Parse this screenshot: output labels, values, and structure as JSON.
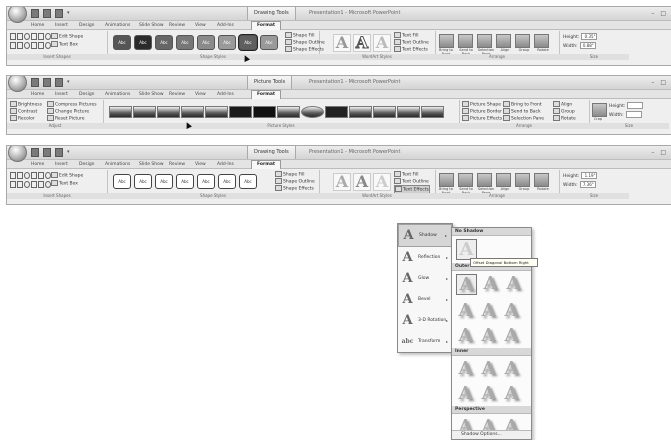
{
  "window_title": "Presentation1 - Microsoft PowerPoint",
  "tabs": [
    "Home",
    "Insert",
    "Design",
    "Animations",
    "Slide Show",
    "Review",
    "View",
    "Add-Ins"
  ],
  "ribbon1": {
    "tools_label": "Drawing Tools",
    "format_tab": "Format",
    "edit_shape": "Edit Shape",
    "text_box": "Text Box",
    "style_label": "Abc",
    "shape_fill": "Shape Fill",
    "shape_outline": "Shape Outline",
    "shape_effects": "Shape Effects",
    "text_fill": "Text Fill",
    "text_outline": "Text Outline",
    "text_effects": "Text Effects",
    "arrange": [
      "Bring to Front",
      "Send to Back",
      "Selection Pane",
      "Align",
      "Group",
      "Rotate"
    ],
    "height_label": "Height:",
    "height_value": "0.35\"",
    "width_label": "Width:",
    "width_value": "0.88\"",
    "groups": [
      "Insert Shapes",
      "Shape Styles",
      "WordArt Styles",
      "Arrange",
      "Size"
    ]
  },
  "ribbon2": {
    "tools_label": "Picture Tools",
    "format_tab": "Format",
    "adjust": [
      "Brightness",
      "Contrast",
      "Recolor",
      "Compress Pictures",
      "Change Picture",
      "Reset Picture"
    ],
    "picture_shape": "Picture Shape",
    "picture_border": "Picture Border",
    "picture_effects": "Picture Effects",
    "arrange": [
      "Bring to Front",
      "Send to Back",
      "Selection Pane",
      "Align",
      "Group",
      "Rotate"
    ],
    "height_label": "Height:",
    "width_label": "Width:",
    "crop": "Crop",
    "groups": [
      "Adjust",
      "Picture Styles",
      "Arrange",
      "Size"
    ]
  },
  "ribbon3": {
    "tools_label": "Drawing Tools",
    "format_tab": "Format",
    "edit_shape": "Edit Shape",
    "text_box": "Text Box",
    "style_label": "Abc",
    "shape_fill": "Shape Fill",
    "shape_outline": "Shape Outline",
    "shape_effects": "Shape Effects",
    "text_fill": "Text Fill",
    "text_outline": "Text Outline",
    "text_effects": "Text Effects",
    "arrange": [
      "Bring to Front",
      "Send to Back",
      "Selection Pane",
      "Align",
      "Group",
      "Rotate"
    ],
    "height_label": "Height:",
    "height_value": "1.19\"",
    "width_label": "Width:",
    "width_value": "7.36\"",
    "groups": [
      "Insert Shapes",
      "Shape Styles",
      "WordArt Styles",
      "Arrange",
      "Size"
    ]
  },
  "effects_menu": [
    {
      "label": "Shadow",
      "icon": "A"
    },
    {
      "label": "Reflection",
      "icon": "A"
    },
    {
      "label": "Glow",
      "icon": "A"
    },
    {
      "label": "Bevel",
      "icon": "A"
    },
    {
      "label": "3-D Rotation",
      "icon": "A"
    },
    {
      "label": "Transform",
      "icon": "abc"
    }
  ],
  "shadow_gallery": {
    "no_shadow": "No Shadow",
    "outer": "Outer",
    "inner": "Inner",
    "perspective": "Perspective",
    "tooltip": "Offset Diagonal Bottom Right",
    "options": "Shadow Options..."
  },
  "colors": {
    "ribbon_bg": "#efefef",
    "dark_swatch": "#2b2b2b",
    "mid_swatch": "#6a6a6a"
  }
}
